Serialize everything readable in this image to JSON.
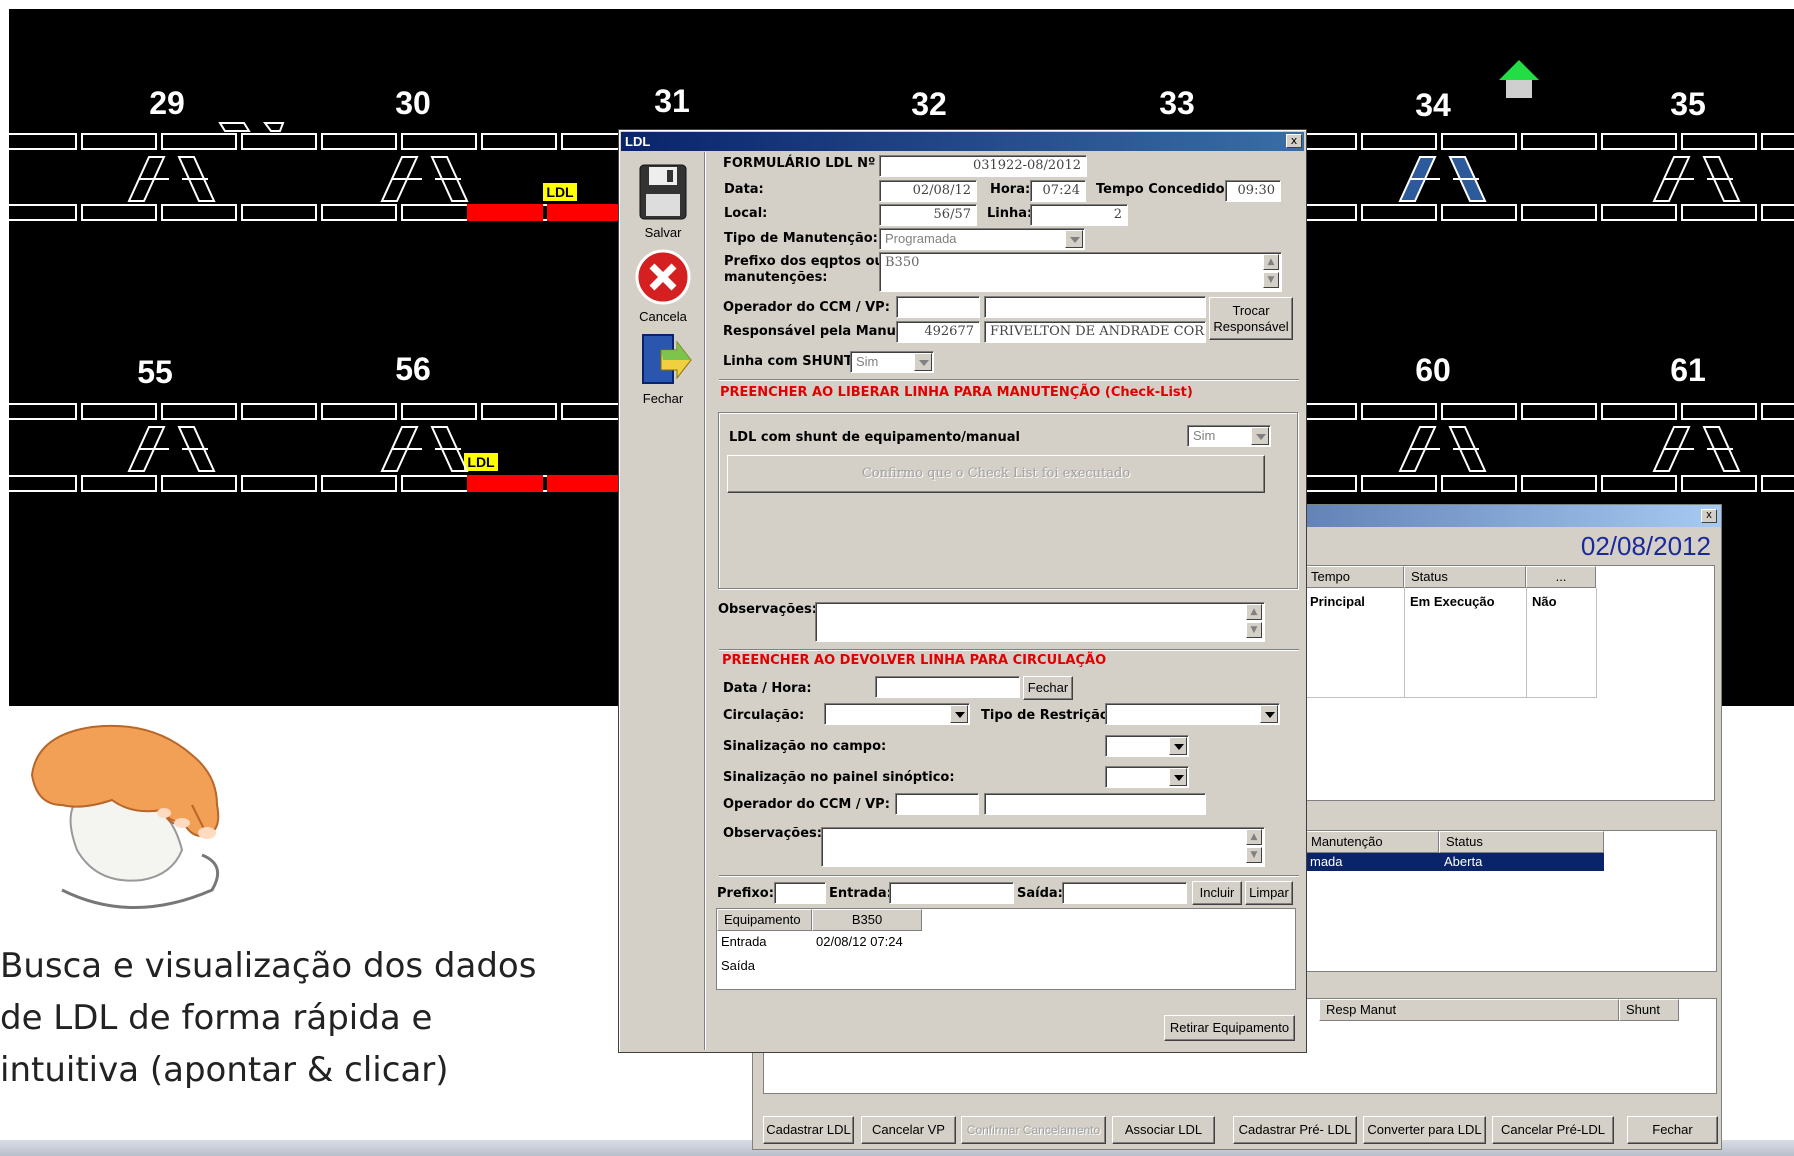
{
  "synoptic": {
    "track_numbers_top": [
      "29",
      "30",
      "31",
      "32",
      "33",
      "34",
      "35"
    ],
    "track_numbers_bottom": [
      "55",
      "56",
      "60",
      "61"
    ],
    "ldl_flag": "LDL",
    "colors": {
      "background": "#000000",
      "occupied": "#ff0000",
      "track": "#ffffff",
      "flag": "#ffff00",
      "arrow": "#00cc44"
    }
  },
  "caption": {
    "line1": "Busca e visualização dos dados",
    "line2": "de LDL de forma rápida e",
    "line3": "intuitiva (apontar & clicar)"
  },
  "back_window": {
    "close_label": "x",
    "date": "02/08/2012",
    "grid1": {
      "headers": [
        "Tempo",
        "Status",
        "..."
      ],
      "row": [
        "Principal",
        "Em Execução",
        "Não"
      ]
    },
    "grid2": {
      "headers": [
        "Manutenção",
        "Status"
      ],
      "row": [
        "mada",
        "Aberta"
      ]
    },
    "grid3": {
      "headers": [
        "Resp Manut",
        "Shunt"
      ]
    },
    "buttons": {
      "cadastrar_ldl": "Cadastrar LDL",
      "cancelar_vp": "Cancelar VP",
      "confirmar_cancelamento": "Confirmar Cancelamento",
      "associar_ldl": "Associar LDL",
      "cadastrar_pre_ldl": "Cadastrar Pré- LDL",
      "converter_para_ldl": "Converter para LDL",
      "cancelar_pre_ldl": "Cancelar Pré-LDL",
      "fechar": "Fechar"
    }
  },
  "ldl_dialog": {
    "title": "LDL",
    "close_label": "x",
    "toolbar": {
      "salvar": "Salvar",
      "cancela": "Cancela",
      "fechar": "Fechar"
    },
    "labels": {
      "formulario": "FORMULÁRIO LDL Nº .:",
      "data": "Data:",
      "hora": "Hora:",
      "tempo_concedido": "Tempo Concedido:",
      "local": "Local:",
      "linha": "Linha:",
      "tipo_manutencao": "Tipo de Manutenção:",
      "prefixo_line1": "Prefixo dos eqptos ou",
      "prefixo_line2": "manutenções:",
      "operador_ccm": "Operador do CCM / VP:",
      "responsavel": "Responsável pela Manut:",
      "linha_shunt": "Linha com SHUNT:",
      "checklist_header": "PREENCHER AO LIBERAR LINHA PARA MANUTENÇÃO (Check-List)",
      "ldl_shunt": "LDL com shunt de equipamento/manual",
      "observacoes": "Observações:",
      "devolver_header": "PREENCHER AO DEVOLVER LINHA PARA CIRCULAÇÃO",
      "data_hora": "Data / Hora:",
      "circulacao": "Circulação:",
      "tipo_restricao": "Tipo de Restrição:",
      "sinal_campo": "Sinalização no campo:",
      "sinal_painel": "Sinalização no painel sinóptico:",
      "operador_ccm2": "Operador do CCM / VP:",
      "observacoes2": "Observações:",
      "prefixo": "Prefixo:",
      "entrada": "Entrada:",
      "saida": "Saída:"
    },
    "values": {
      "formulario": "031922-08/2012",
      "data": "02/08/12",
      "hora": "07:24",
      "tempo_concedido": "09:30",
      "local": "56/57",
      "linha": "2",
      "tipo_manutencao": "Programada",
      "prefixo": "B350",
      "responsavel_id": "492677",
      "responsavel_nome": "FRIVELTON DE ANDRADE CORDEIRO",
      "linha_shunt": "Sim",
      "ldl_shunt": "Sim"
    },
    "buttons": {
      "trocar_line1": "Trocar",
      "trocar_line2": "Responsável",
      "confirmo": "Confirmo que o Check List foi executado",
      "fechar": "Fechar",
      "incluir": "Incluir",
      "limpar": "Limpar",
      "retirar": "Retirar Equipamento"
    },
    "equip_grid": {
      "headers": [
        "Equipamento",
        "B350"
      ],
      "rows": [
        [
          "Entrada",
          "02/08/12 07:24"
        ],
        [
          "Saída",
          ""
        ]
      ]
    }
  }
}
